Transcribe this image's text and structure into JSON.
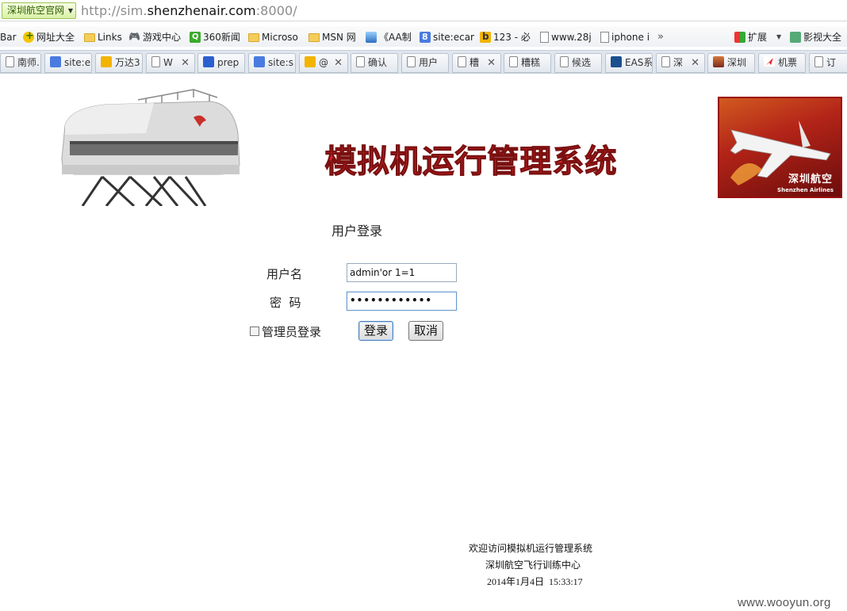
{
  "browser": {
    "site_badge": "深圳航空官网",
    "url_prefix": "http://sim.",
    "url_host": "shenzhenair.com",
    "url_suffix": ":8000/",
    "bookmarks": [
      {
        "label": "Bar",
        "icon": "none"
      },
      {
        "label": "网址大全",
        "icon": "plus-icon"
      },
      {
        "label": "Links",
        "icon": "folder-icon"
      },
      {
        "label": "游戏中心",
        "icon": "game-icon"
      },
      {
        "label": "360新闻",
        "icon": "news-icon"
      },
      {
        "label": "Microso",
        "icon": "folder-icon"
      },
      {
        "label": "MSN 网",
        "icon": "folder-icon"
      },
      {
        "label": "《AA制",
        "icon": "photo-icon"
      },
      {
        "label": "site:ecar",
        "icon": "search-icon"
      },
      {
        "label": "123 - 必",
        "icon": "bing-icon"
      },
      {
        "label": "www.28j",
        "icon": "page-icon"
      },
      {
        "label": "iphone i",
        "icon": "page-icon"
      }
    ],
    "bookmarks_more": "»",
    "ext_label": "扩展",
    "video_label": "影视大全",
    "tabs": [
      {
        "label": "南师.",
        "icon": "page-icon"
      },
      {
        "label": "site:e",
        "icon": "search-icon"
      },
      {
        "label": "万达3",
        "icon": "bing-icon"
      },
      {
        "label": "W",
        "icon": "page-icon"
      },
      {
        "label": "prep",
        "icon": "paw-icon"
      },
      {
        "label": "site:s",
        "icon": "search-icon"
      },
      {
        "label": "@",
        "icon": "bing-icon"
      },
      {
        "label": "确认",
        "icon": "page-icon"
      },
      {
        "label": "用户",
        "icon": "page-icon"
      },
      {
        "label": "糟",
        "icon": "page-icon"
      },
      {
        "label": "糟糕",
        "icon": "page-icon"
      },
      {
        "label": "候选",
        "icon": "page-icon"
      },
      {
        "label": "EAS系",
        "icon": "eas-icon"
      },
      {
        "label": "深",
        "icon": "page-icon"
      },
      {
        "label": "深圳",
        "icon": "photo-icon"
      },
      {
        "label": "机票",
        "icon": "plane-icon"
      },
      {
        "label": "订",
        "icon": "page-icon"
      }
    ]
  },
  "page": {
    "banner_title": "模拟机运行管理系统",
    "logo_text": "深圳航空",
    "logo_sub": "Shenzhen Airlines",
    "login_title": "用户登录",
    "username_label": "用户名",
    "username_value": "admin'or 1=1",
    "password_label": "密  码",
    "password_value": "••••••••••••",
    "admin_login_label": "管理员登录",
    "admin_login_checked": false,
    "login_button": "登录",
    "cancel_button": "取消",
    "footer_line1": "欢迎访问模拟机运行管理系统",
    "footer_line2": "深圳航空飞行训练中心",
    "footer_date": "2014年1月4日  15:33:17",
    "watermark": "www.wooyun.org"
  },
  "colors": {
    "banner_red": "#e4232a",
    "logo_red": "#b32418"
  }
}
